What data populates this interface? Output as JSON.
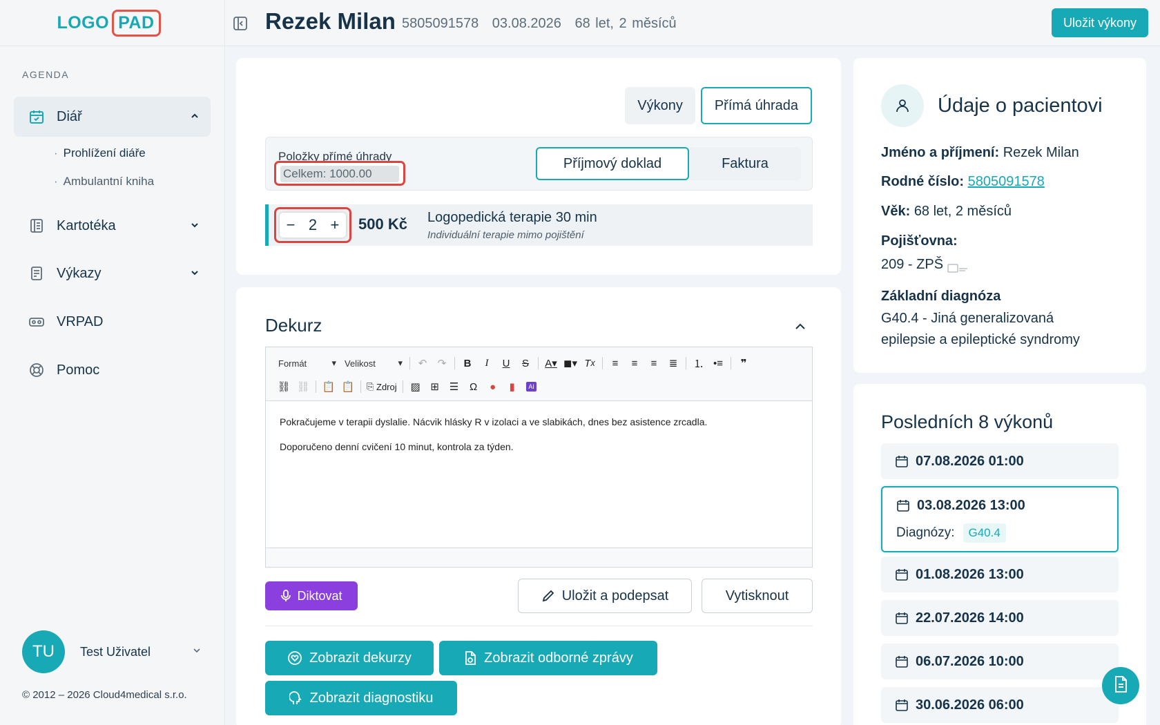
{
  "logo": {
    "part1": "LOGO",
    "part2": "PAD"
  },
  "sidebar": {
    "section_label": "AGENDA",
    "items": [
      {
        "label": "Diář",
        "icon": "calendar-icon",
        "expanded": true
      },
      {
        "label": "Kartotéka",
        "icon": "book-icon"
      },
      {
        "label": "Výkazy",
        "icon": "report-icon"
      },
      {
        "label": "VRPAD",
        "icon": "vr-headset-icon"
      },
      {
        "label": "Pomoc",
        "icon": "lifebuoy-icon"
      }
    ],
    "sub_items": [
      {
        "label": "Prohlížení diáře"
      },
      {
        "label": "Ambulantní kniha"
      }
    ],
    "user": {
      "initials": "TU",
      "name": "Test Uživatel"
    },
    "copyright": "© 2012 – 2026 Cloud4medical s.r.o."
  },
  "header": {
    "patient_name": "Rezek Milan",
    "birth_number": "5805091578",
    "date": "03.08.2026",
    "age": "68 let, 2 měsíců",
    "save_label": "Uložit výkony"
  },
  "tabs": [
    "Výkony",
    "Přímá úhrada"
  ],
  "direct_payment": {
    "title": "Položky přímé úhrady",
    "total": "Celkem: 1000.00",
    "doc_types": [
      "Příjmový doklad",
      "Faktura"
    ],
    "items": [
      {
        "qty": "2",
        "price": "500 Kč",
        "name": "Logopedická terapie 30 min",
        "desc": "Individuální terapie mimo pojištění"
      }
    ]
  },
  "dekurz": {
    "title": "Dekurz",
    "toolbar": {
      "format_label": "Formát",
      "size_label": "Velikost",
      "source_label": "Zdroj"
    },
    "paragraphs": [
      "Pokračujeme v terapii dyslalie. Nácvik hlásky R v izolaci a ve slabikách, dnes bez asistence zrcadla.",
      "Doporučeno denní cvičení 10 minut, kontrola za týden."
    ],
    "dictate_label": "Diktovat",
    "sign_label": "Uložit a podepsat",
    "print_label": "Vytisknout",
    "show_dekurz_label": "Zobrazit dekurzy",
    "show_reports_label": "Zobrazit odborné zprávy",
    "show_diag_label": "Zobrazit diagnostiku"
  },
  "patient_info": {
    "title": "Údaje o pacientovi",
    "name_label": "Jméno a příjmení:",
    "name": "Rezek Milan",
    "rc_label": "Rodné číslo:",
    "rc": "5805091578",
    "age_label": "Věk:",
    "age": "68 let, 2 měsíců",
    "insurer_label": "Pojišťovna:",
    "insurer": "209 - ZPŠ",
    "diagnosis_label": "Základní diagnóza",
    "diagnosis_line1": "G40.4 - Jiná generalizovaná",
    "diagnosis_line2": "epilepsie a epileptické syndromy"
  },
  "visits": {
    "title": "Posledních 8 výkonů",
    "diag_label": "Diagnózy:",
    "list": [
      {
        "date": "07.08.2026 01:00"
      },
      {
        "date": "03.08.2026 13:00",
        "diag": "G40.4",
        "selected": true
      },
      {
        "date": "01.08.2026 13:00"
      },
      {
        "date": "22.07.2026 14:00"
      },
      {
        "date": "06.07.2026 10:00"
      },
      {
        "date": "30.06.2026 06:00"
      }
    ]
  },
  "colors": {
    "accent": "#17a9b5",
    "dictate": "#8a3fde",
    "highlight": "#d9463f"
  }
}
